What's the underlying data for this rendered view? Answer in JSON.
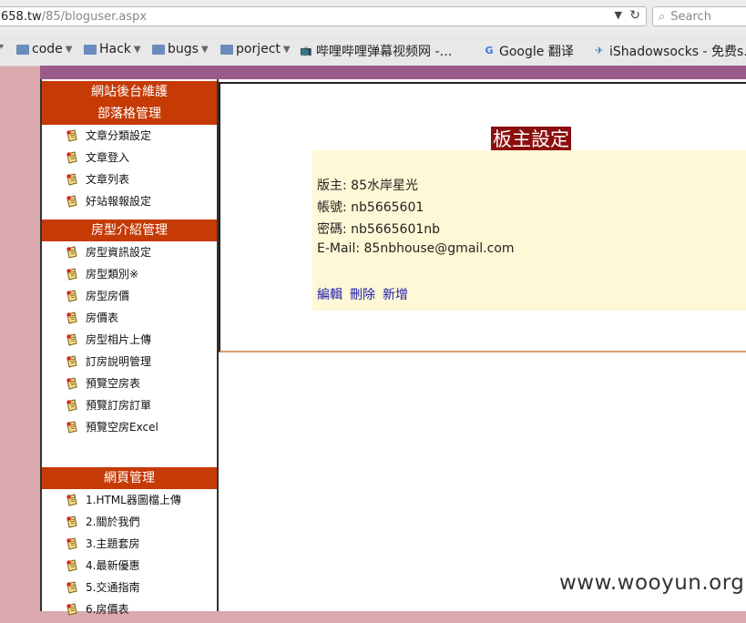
{
  "browser": {
    "url_host": "658.tw",
    "url_path": "/85/bloguser.aspx",
    "search_placeholder": "Search",
    "bookmarks": [
      {
        "label": "code",
        "icon": "folder-icon",
        "dropdown": true
      },
      {
        "label": "Hack",
        "icon": "folder-icon",
        "dropdown": true
      },
      {
        "label": "bugs",
        "icon": "folder-icon",
        "dropdown": true
      },
      {
        "label": "porject",
        "icon": "folder-icon",
        "dropdown": true
      },
      {
        "label": "哔哩哔哩弹幕视频网 -…",
        "icon": "tv-icon",
        "dropdown": false
      },
      {
        "label": "Google 翻译",
        "icon": "translate-icon",
        "dropdown": false
      },
      {
        "label": "iShadowsocks - 免费s...",
        "icon": "telegram-icon",
        "dropdown": false
      }
    ]
  },
  "sidebar": {
    "header_main": "網站後台維護",
    "sections": [
      {
        "title": "部落格管理",
        "items": [
          "文章分類設定",
          "文章登入",
          "文章列表",
          "好站報報設定"
        ]
      },
      {
        "title": "房型介紹管理",
        "items": [
          "房型資訊設定",
          "房型類別※",
          "房型房價",
          "房價表",
          "房型相片上傳",
          "訂房說明管理",
          "預覽空房表",
          "預覽訂房訂單",
          "預覽空房Excel"
        ]
      },
      {
        "title": "網頁管理",
        "items": [
          "1.HTML器圖檔上傳",
          "2.關於我們",
          "3.主題套房",
          "4.最新優惠",
          "5.交通指南",
          "6.房價表"
        ]
      }
    ]
  },
  "main": {
    "title": "板主設定",
    "owner_label": "版主: 85水岸星光",
    "account_label": "帳號: nb5665601",
    "password_label": "密碼: nb5665601nb",
    "email_label": "E-Mail: 85nbhouse@gmail.com",
    "actions": [
      "編輯",
      "刪除",
      "新增"
    ]
  },
  "watermark": "www.wooyun.org",
  "colors": {
    "section_header": "#c53a05",
    "title_bg": "#8b0f0f",
    "info_bg": "#fff8d6",
    "nav_bg": "#9b5b8a",
    "page_bg": "#d9a9ad"
  }
}
